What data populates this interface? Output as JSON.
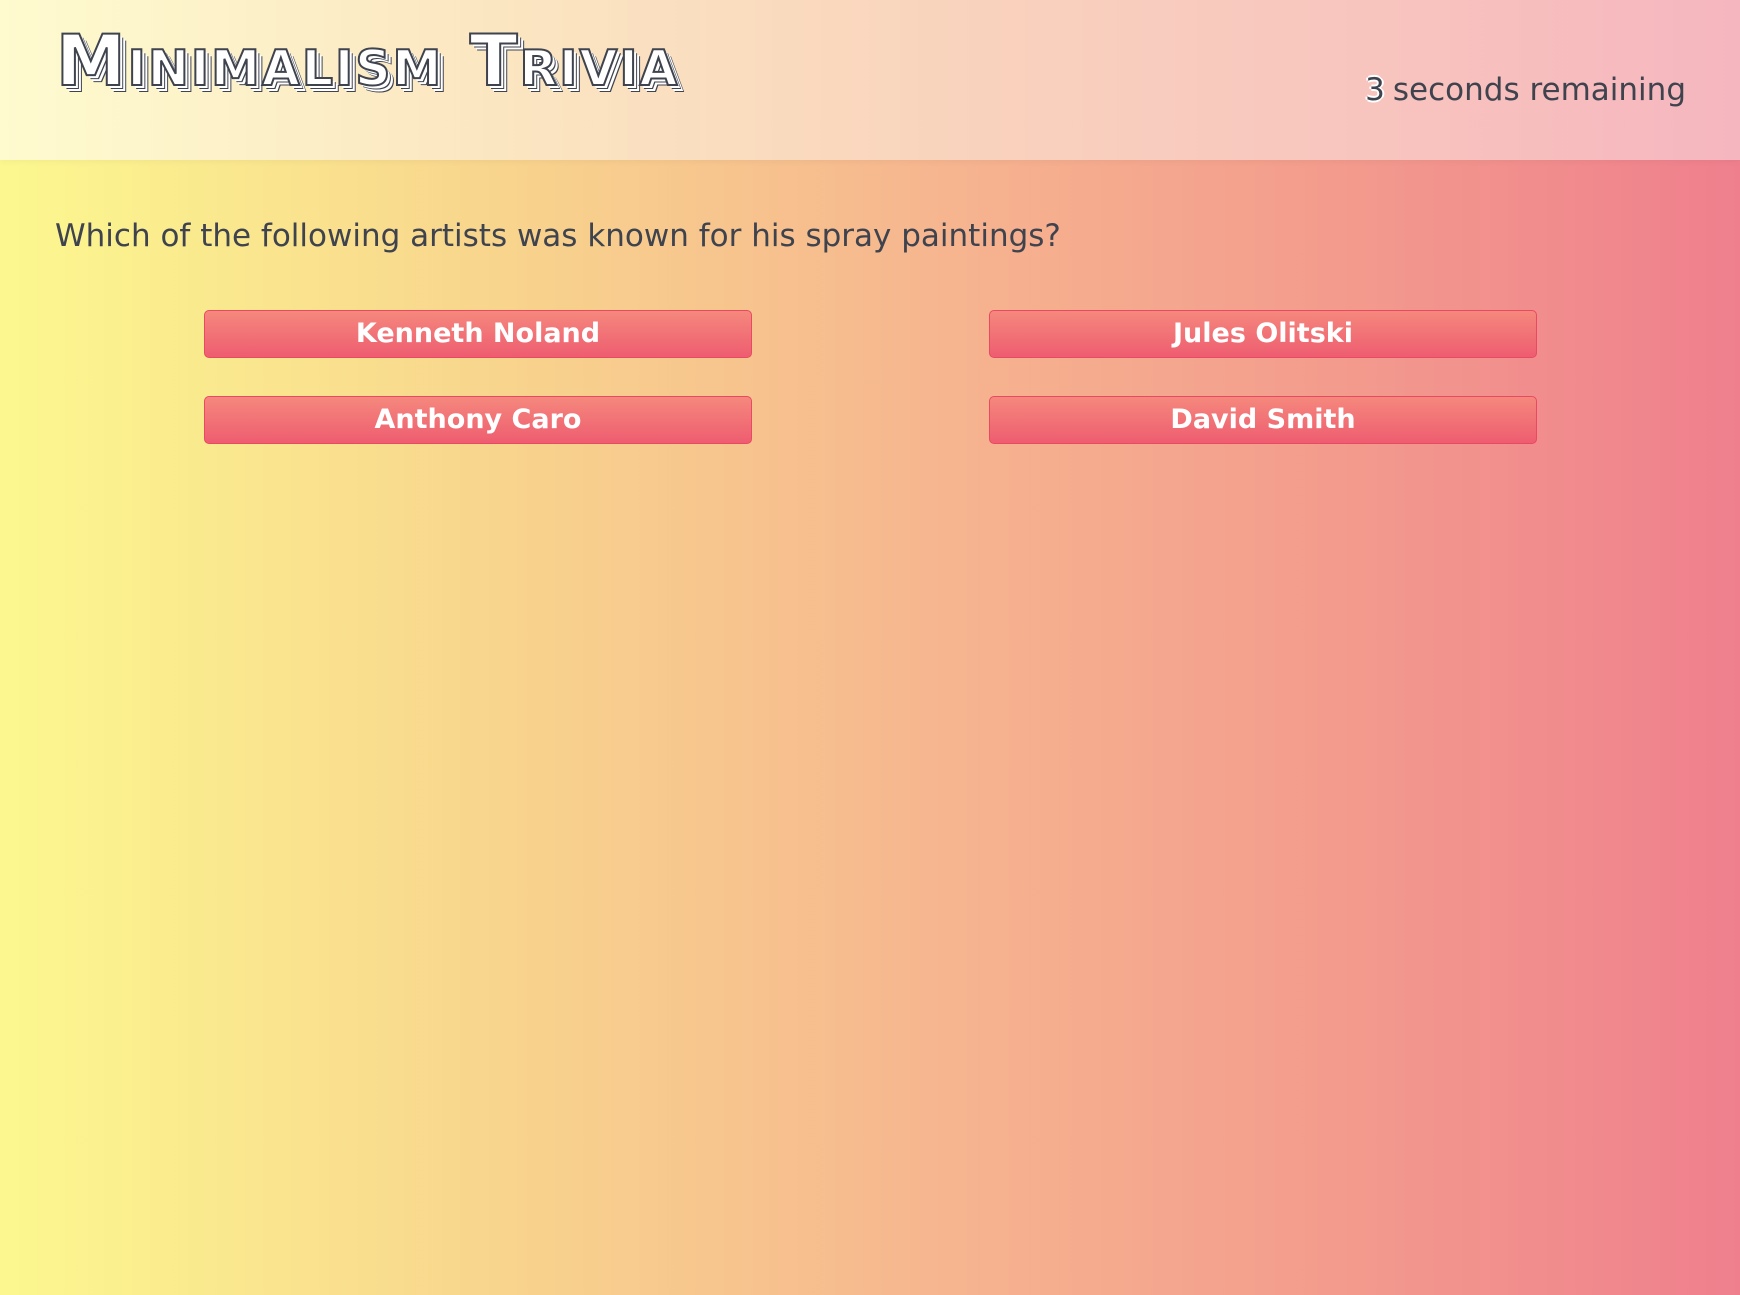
{
  "header": {
    "title": "Minimalism Trivia",
    "timer": {
      "count": "3",
      "label": "seconds remaining"
    }
  },
  "question": {
    "text": "Which of the following artists was known for his spray paintings?",
    "answers": [
      {
        "label": "Kenneth Noland"
      },
      {
        "label": "Jules Olitski"
      },
      {
        "label": "Anthony Caro"
      },
      {
        "label": "David Smith"
      }
    ]
  },
  "colors": {
    "text": "#3f434e",
    "button_top": "#f5887d",
    "button_bottom": "#ee5d70",
    "button_border": "#e94963",
    "background_left": "#fcf88f",
    "background_right": "#ef7f8d"
  }
}
